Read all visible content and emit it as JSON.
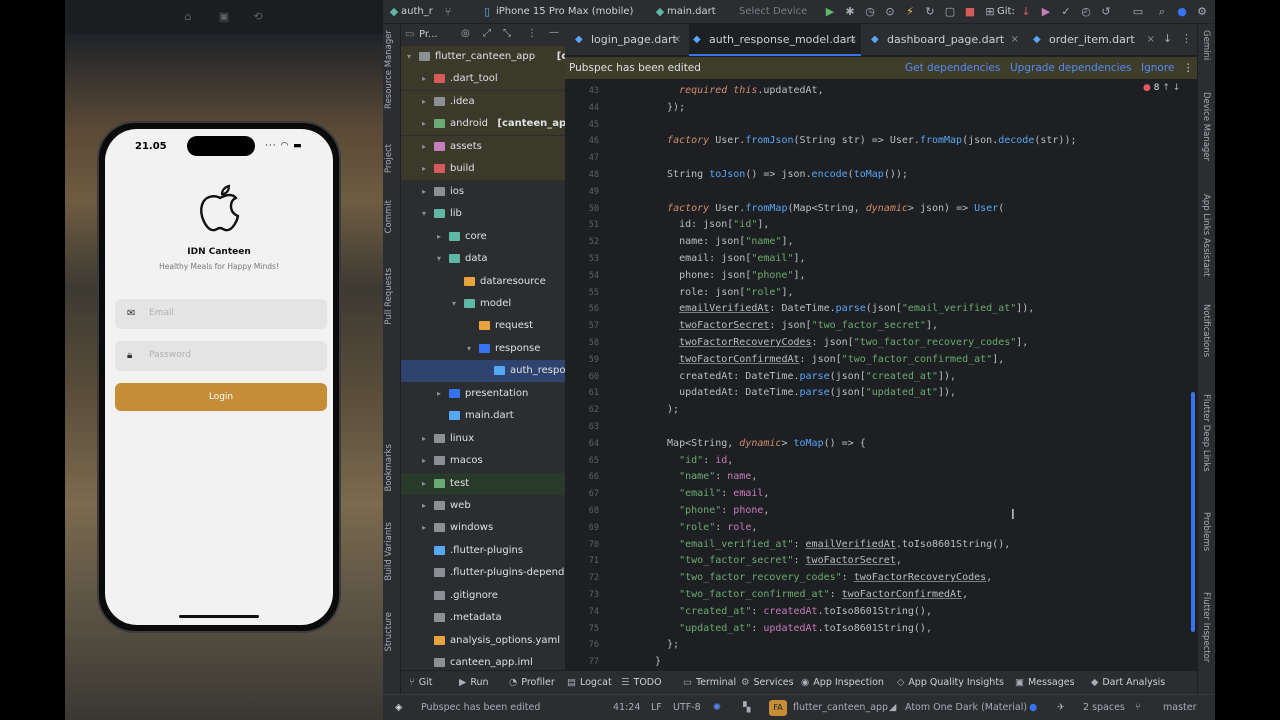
{
  "simulator": {
    "status_time": "21.05",
    "app_title": "IDN Canteen",
    "app_subtitle": "Healthy Meals for Happy Minds!",
    "email_placeholder": "Email",
    "password_placeholder": "Password",
    "login_label": "Login",
    "accent": "#c48d36"
  },
  "toolbar": {
    "project": "auth_r",
    "device": "iPhone 15 Pro Max (mobile)",
    "run_config": "main.dart",
    "select_device": "Select Device",
    "git_label": "Git:"
  },
  "project_panel": {
    "header": "Pr...",
    "rows": [
      {
        "label": "flutter_canteen_app",
        "suffix": "[cantee",
        "level": 0,
        "arrow": "open",
        "color": "#8c8f94"
      },
      {
        "label": ".dart_tool",
        "suffix": "",
        "level": 1,
        "arrow": "closed",
        "color": "#d75b5b"
      },
      {
        "label": ".idea",
        "suffix": "",
        "level": 1,
        "arrow": "closed",
        "color": "#8c8f94"
      },
      {
        "label": "android",
        "suffix": "[canteen_app_a",
        "level": 1,
        "arrow": "closed",
        "color": "#6aab73"
      },
      {
        "label": "assets",
        "suffix": "",
        "level": 1,
        "arrow": "closed",
        "color": "#c77dbb"
      },
      {
        "label": "build",
        "suffix": "",
        "level": 1,
        "arrow": "closed",
        "color": "#d75b5b"
      },
      {
        "label": "ios",
        "suffix": "",
        "level": 1,
        "arrow": "closed",
        "color": "#8c8f94"
      },
      {
        "label": "lib",
        "suffix": "",
        "level": 1,
        "arrow": "open",
        "color": "#5fb8a3"
      },
      {
        "label": "core",
        "suffix": "",
        "level": 2,
        "arrow": "closed",
        "color": "#5fb8a3"
      },
      {
        "label": "data",
        "suffix": "",
        "level": 2,
        "arrow": "open",
        "color": "#5fb8a3"
      },
      {
        "label": "dataresource",
        "suffix": "",
        "level": 3,
        "arrow": "none",
        "color": "#e8a33d"
      },
      {
        "label": "model",
        "suffix": "",
        "level": 3,
        "arrow": "open",
        "color": "#5fb8a3"
      },
      {
        "label": "request",
        "suffix": "",
        "level": 4,
        "arrow": "none",
        "color": "#e8a33d"
      },
      {
        "label": "response",
        "suffix": "",
        "level": 4,
        "arrow": "open",
        "color": "#3574f0"
      },
      {
        "label": "auth_respon",
        "suffix": "",
        "level": 5,
        "arrow": "none",
        "color": "#56a8f5"
      },
      {
        "label": "presentation",
        "suffix": "",
        "level": 2,
        "arrow": "closed",
        "color": "#3574f0"
      },
      {
        "label": "main.dart",
        "suffix": "",
        "level": 2,
        "arrow": "none",
        "color": "#56a8f5"
      },
      {
        "label": "linux",
        "suffix": "",
        "level": 1,
        "arrow": "closed",
        "color": "#8c8f94"
      },
      {
        "label": "macos",
        "suffix": "",
        "level": 1,
        "arrow": "closed",
        "color": "#8c8f94"
      },
      {
        "label": "test",
        "suffix": "",
        "level": 1,
        "arrow": "closed",
        "color": "#6aab73"
      },
      {
        "label": "web",
        "suffix": "",
        "level": 1,
        "arrow": "closed",
        "color": "#8c8f94"
      },
      {
        "label": "windows",
        "suffix": "",
        "level": 1,
        "arrow": "closed",
        "color": "#8c8f94"
      },
      {
        "label": ".flutter-plugins",
        "suffix": "",
        "level": 1,
        "arrow": "none",
        "color": "#56a8f5"
      },
      {
        "label": ".flutter-plugins-depende",
        "suffix": "",
        "level": 1,
        "arrow": "none",
        "color": "#8c8f94"
      },
      {
        "label": ".gitignore",
        "suffix": "",
        "level": 1,
        "arrow": "none",
        "color": "#8c8f94"
      },
      {
        "label": ".metadata",
        "suffix": "",
        "level": 1,
        "arrow": "none",
        "color": "#8c8f94"
      },
      {
        "label": "analysis_options.yaml",
        "suffix": "",
        "level": 1,
        "arrow": "none",
        "color": "#e8a33d"
      },
      {
        "label": "canteen_app.iml",
        "suffix": "",
        "level": 1,
        "arrow": "none",
        "color": "#8c8f94"
      }
    ]
  },
  "tabs": [
    {
      "label": "login_page.dart",
      "active": false
    },
    {
      "label": "auth_response_model.dart",
      "active": true
    },
    {
      "label": "dashboard_page.dart",
      "active": false
    },
    {
      "label": "order_item.dart",
      "active": false
    }
  ],
  "banner": {
    "message": "Pubspec has been edited",
    "get": "Get dependencies",
    "upgrade": "Upgrade dependencies",
    "ignore": "Ignore",
    "problem_count": "8"
  },
  "code": {
    "first_line": 43,
    "lines": [
      [
        [
          "    ",
          "t"
        ],
        [
          "required ",
          "k"
        ],
        [
          "this",
          "k"
        ],
        [
          ".updatedAt,",
          "t"
        ]
      ],
      [
        [
          "  });",
          "t"
        ]
      ],
      [
        [
          "",
          "t"
        ]
      ],
      [
        [
          "  ",
          "t"
        ],
        [
          "factory ",
          "k"
        ],
        [
          "User.",
          "t"
        ],
        [
          "fromJson",
          "f"
        ],
        [
          "(String str) => User.",
          "t"
        ],
        [
          "fromMap",
          "f"
        ],
        [
          "(json.",
          "t"
        ],
        [
          "decode",
          "f"
        ],
        [
          "(str));",
          "t"
        ]
      ],
      [
        [
          "",
          "t"
        ]
      ],
      [
        [
          "  String ",
          "t"
        ],
        [
          "toJson",
          "f"
        ],
        [
          "() => json.",
          "t"
        ],
        [
          "encode",
          "f"
        ],
        [
          "(",
          "t"
        ],
        [
          "toMap",
          "f"
        ],
        [
          "());",
          "t"
        ]
      ],
      [
        [
          "",
          "t"
        ]
      ],
      [
        [
          "  ",
          "t"
        ],
        [
          "factory ",
          "k"
        ],
        [
          "User.",
          "t"
        ],
        [
          "fromMap",
          "f"
        ],
        [
          "(Map<String, ",
          "t"
        ],
        [
          "dynamic",
          "k"
        ],
        [
          "> json) => ",
          "t"
        ],
        [
          "User",
          "f"
        ],
        [
          "(",
          "t"
        ]
      ],
      [
        [
          "    id: json[",
          "t"
        ],
        [
          "\"id\"",
          "s"
        ],
        [
          "],",
          "t"
        ]
      ],
      [
        [
          "    name: json[",
          "t"
        ],
        [
          "\"name\"",
          "s"
        ],
        [
          "],",
          "t"
        ]
      ],
      [
        [
          "    email: json[",
          "t"
        ],
        [
          "\"email\"",
          "s"
        ],
        [
          "],",
          "t"
        ]
      ],
      [
        [
          "    phone: json[",
          "t"
        ],
        [
          "\"phone\"",
          "s"
        ],
        [
          "],",
          "t"
        ]
      ],
      [
        [
          "    role: json[",
          "t"
        ],
        [
          "\"role\"",
          "s"
        ],
        [
          "],",
          "t"
        ]
      ],
      [
        [
          "    ",
          "t"
        ],
        [
          "emailVerifiedAt",
          "u"
        ],
        [
          ": DateTime.",
          "t"
        ],
        [
          "parse",
          "f"
        ],
        [
          "(json[",
          "t"
        ],
        [
          "\"email_verified_at\"",
          "s"
        ],
        [
          "]),",
          "t"
        ]
      ],
      [
        [
          "    ",
          "t"
        ],
        [
          "twoFactorSecret",
          "u"
        ],
        [
          ": json[",
          "t"
        ],
        [
          "\"two_factor_secret\"",
          "s"
        ],
        [
          "],",
          "t"
        ]
      ],
      [
        [
          "    ",
          "t"
        ],
        [
          "twoFactorRecoveryCodes",
          "u"
        ],
        [
          ": json[",
          "t"
        ],
        [
          "\"two_factor_recovery_codes\"",
          "s"
        ],
        [
          "],",
          "t"
        ]
      ],
      [
        [
          "    ",
          "t"
        ],
        [
          "twoFactorConfirmedAt",
          "u"
        ],
        [
          ": json[",
          "t"
        ],
        [
          "\"two_factor_confirmed_at\"",
          "s"
        ],
        [
          "],",
          "t"
        ]
      ],
      [
        [
          "    createdAt: DateTime.",
          "t"
        ],
        [
          "parse",
          "f"
        ],
        [
          "(json[",
          "t"
        ],
        [
          "\"created_at\"",
          "s"
        ],
        [
          "]),",
          "t"
        ]
      ],
      [
        [
          "    updatedAt: DateTime.",
          "t"
        ],
        [
          "parse",
          "f"
        ],
        [
          "(json[",
          "t"
        ],
        [
          "\"updated_at\"",
          "s"
        ],
        [
          "]),",
          "t"
        ]
      ],
      [
        [
          "  );",
          "t"
        ]
      ],
      [
        [
          "",
          "t"
        ]
      ],
      [
        [
          "  Map<String, ",
          "t"
        ],
        [
          "dynamic",
          "k"
        ],
        [
          "> ",
          "t"
        ],
        [
          "toMap",
          "f"
        ],
        [
          "() => {",
          "t"
        ]
      ],
      [
        [
          "    ",
          "t"
        ],
        [
          "\"id\"",
          "s"
        ],
        [
          ": ",
          "t"
        ],
        [
          "id",
          "p"
        ],
        [
          ",",
          "t"
        ]
      ],
      [
        [
          "    ",
          "t"
        ],
        [
          "\"name\"",
          "s"
        ],
        [
          ": ",
          "t"
        ],
        [
          "name",
          "p"
        ],
        [
          ",",
          "t"
        ]
      ],
      [
        [
          "    ",
          "t"
        ],
        [
          "\"email\"",
          "s"
        ],
        [
          ": ",
          "t"
        ],
        [
          "email",
          "p"
        ],
        [
          ",",
          "t"
        ]
      ],
      [
        [
          "    ",
          "t"
        ],
        [
          "\"phone\"",
          "s"
        ],
        [
          ": ",
          "t"
        ],
        [
          "phone",
          "p"
        ],
        [
          ",",
          "t"
        ]
      ],
      [
        [
          "    ",
          "t"
        ],
        [
          "\"role\"",
          "s"
        ],
        [
          ": ",
          "t"
        ],
        [
          "role",
          "p"
        ],
        [
          ",",
          "t"
        ]
      ],
      [
        [
          "    ",
          "t"
        ],
        [
          "\"email_verified_at\"",
          "s"
        ],
        [
          ": ",
          "t"
        ],
        [
          "emailVerifiedAt",
          "u"
        ],
        [
          ".toIso8601String(),",
          "t"
        ]
      ],
      [
        [
          "    ",
          "t"
        ],
        [
          "\"two_factor_secret\"",
          "s"
        ],
        [
          ": ",
          "t"
        ],
        [
          "twoFactorSecret",
          "u"
        ],
        [
          ",",
          "t"
        ]
      ],
      [
        [
          "    ",
          "t"
        ],
        [
          "\"two_factor_recovery_codes\"",
          "s"
        ],
        [
          ": ",
          "t"
        ],
        [
          "twoFactorRecoveryCodes",
          "u"
        ],
        [
          ",",
          "t"
        ]
      ],
      [
        [
          "    ",
          "t"
        ],
        [
          "\"two_factor_confirmed_at\"",
          "s"
        ],
        [
          ": ",
          "t"
        ],
        [
          "twoFactorConfirmedAt",
          "u"
        ],
        [
          ",",
          "t"
        ]
      ],
      [
        [
          "    ",
          "t"
        ],
        [
          "\"created_at\"",
          "s"
        ],
        [
          ": ",
          "t"
        ],
        [
          "createdAt",
          "p"
        ],
        [
          ".toIso8601String(),",
          "t"
        ]
      ],
      [
        [
          "    ",
          "t"
        ],
        [
          "\"updated_at\"",
          "s"
        ],
        [
          ": ",
          "t"
        ],
        [
          "updatedAt",
          "p"
        ],
        [
          ".toIso8601String(),",
          "t"
        ]
      ],
      [
        [
          "  };",
          "t"
        ]
      ],
      [
        [
          "}",
          "t"
        ]
      ]
    ]
  },
  "left_strip": [
    "Resource Manager",
    "Project",
    "Commit",
    "Pull Requests",
    "Bookmarks",
    "Build Variants",
    "Structure"
  ],
  "right_strip": [
    "Gemini",
    "Device Manager",
    "App Links Assistant",
    "Notifications",
    "Flutter Deep Links",
    "Problems",
    "Flutter Inspector"
  ],
  "bottom_tools": [
    "Git",
    "Run",
    "Profiler",
    "Logcat",
    "TODO",
    "Terminal",
    "Services",
    "App Inspection",
    "App Quality Insights",
    "Messages",
    "Dart Analysis"
  ],
  "status": {
    "message": "Pubspec has been edited",
    "position": "41:24",
    "line_sep": "LF",
    "encoding": "UTF-8",
    "avatar": "FA",
    "project": "flutter_canteen_app",
    "theme": "Atom One Dark (Material)",
    "indent": "2 spaces",
    "branch": "master"
  }
}
